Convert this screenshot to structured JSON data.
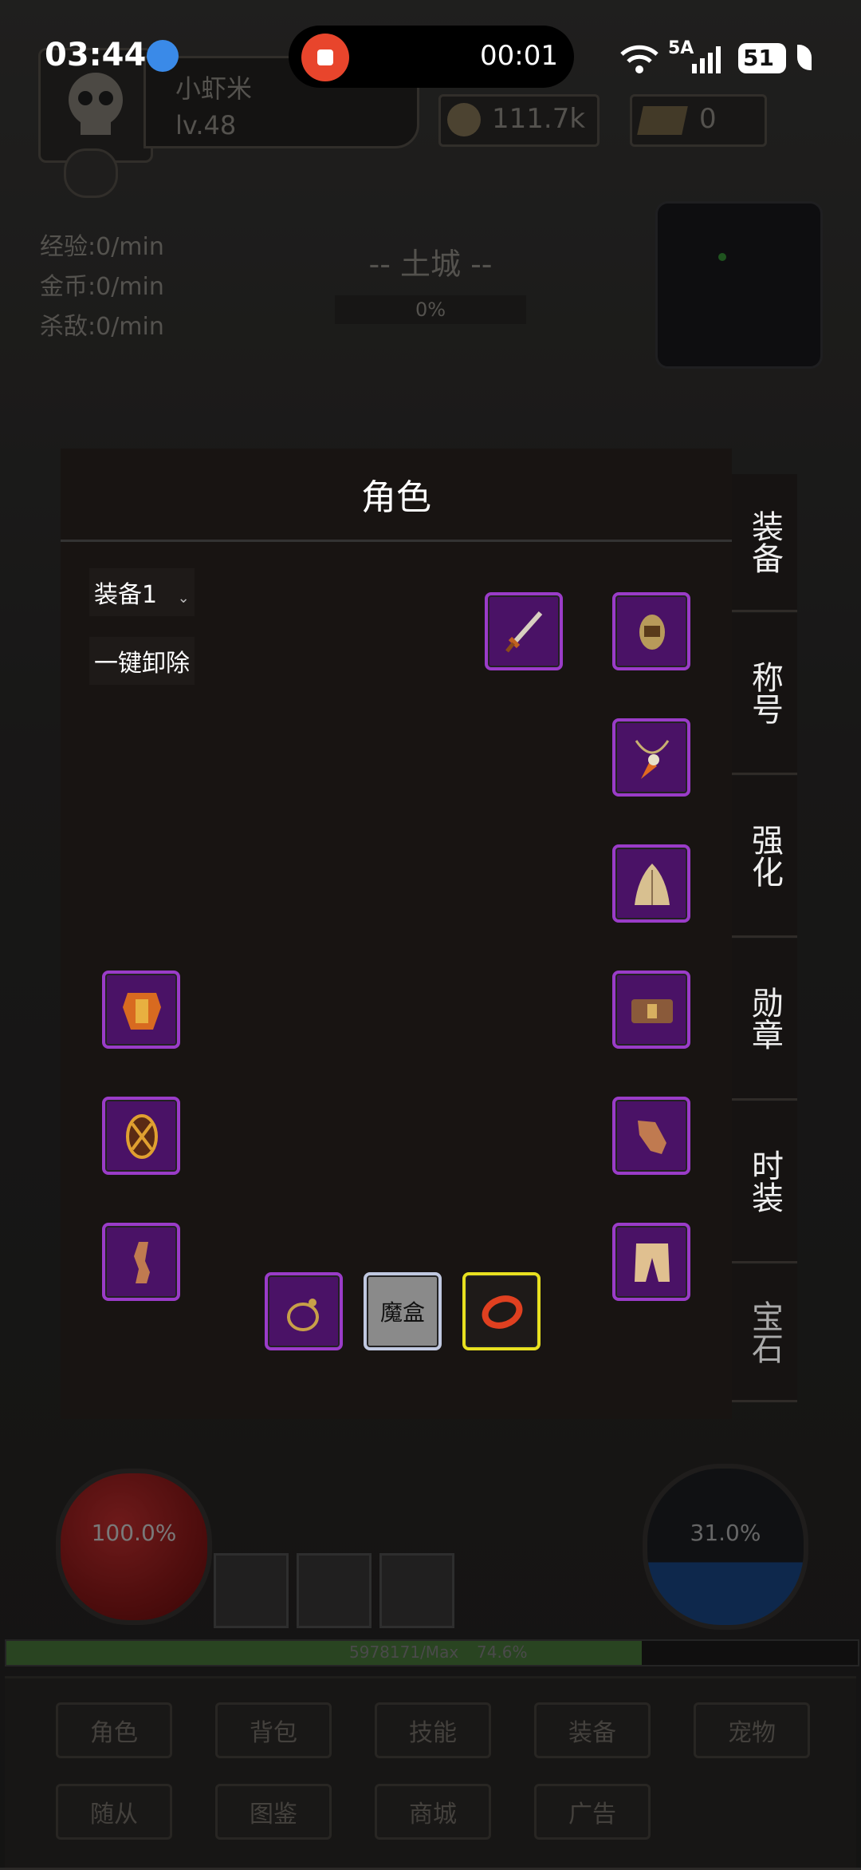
{
  "status_bar": {
    "time": "03:44",
    "recording_time": "00:01",
    "network": "5A",
    "battery": "51"
  },
  "player": {
    "name": "小虾米",
    "level": "lv.48",
    "gold": "111.7k",
    "ingots": "0"
  },
  "stats": {
    "exp_rate": "经验:0/min",
    "gold_rate": "金币:0/min",
    "kill_rate": "杀敌:0/min"
  },
  "location": {
    "name": "-- 土城 --",
    "progress": "0%"
  },
  "dialog": {
    "title": "角色",
    "equip_set": "装备1",
    "unequip_all": "一键卸除",
    "magic_box": "魔盒",
    "side_tabs": [
      {
        "label": "装备"
      },
      {
        "label": "称号"
      },
      {
        "label": "强化"
      },
      {
        "label": "勋章"
      },
      {
        "label": "时装"
      },
      {
        "label": "宝石"
      }
    ],
    "slots": [
      {
        "icon": "sword-icon"
      },
      {
        "icon": "helmet-icon"
      },
      {
        "icon": "necklace-icon"
      },
      {
        "icon": "cloak-icon"
      },
      {
        "icon": "armor-icon"
      },
      {
        "icon": "belt-icon"
      },
      {
        "icon": "shield-icon"
      },
      {
        "icon": "gloves-icon"
      },
      {
        "icon": "boots-icon"
      },
      {
        "icon": "pants-icon"
      },
      {
        "icon": "ring-icon"
      },
      {
        "icon": "ring2-icon"
      }
    ]
  },
  "hud": {
    "hp": "100.0%",
    "mp": "31.0%",
    "exp_text": "5978171/Max",
    "exp_percent": "74.6%",
    "exp_fill": 0.746
  },
  "bottom_menu": [
    "角色",
    "背包",
    "技能",
    "装备",
    "宠物",
    "随从",
    "图鉴",
    "商城",
    "广告"
  ],
  "colors": {
    "slot_border": "#9a3cc8",
    "slot_fill": "#4a1266",
    "magic_box_border": "#c0c8e0",
    "selected_ring_border": "#e8e020",
    "exp_bar": "#4c7c3c"
  }
}
